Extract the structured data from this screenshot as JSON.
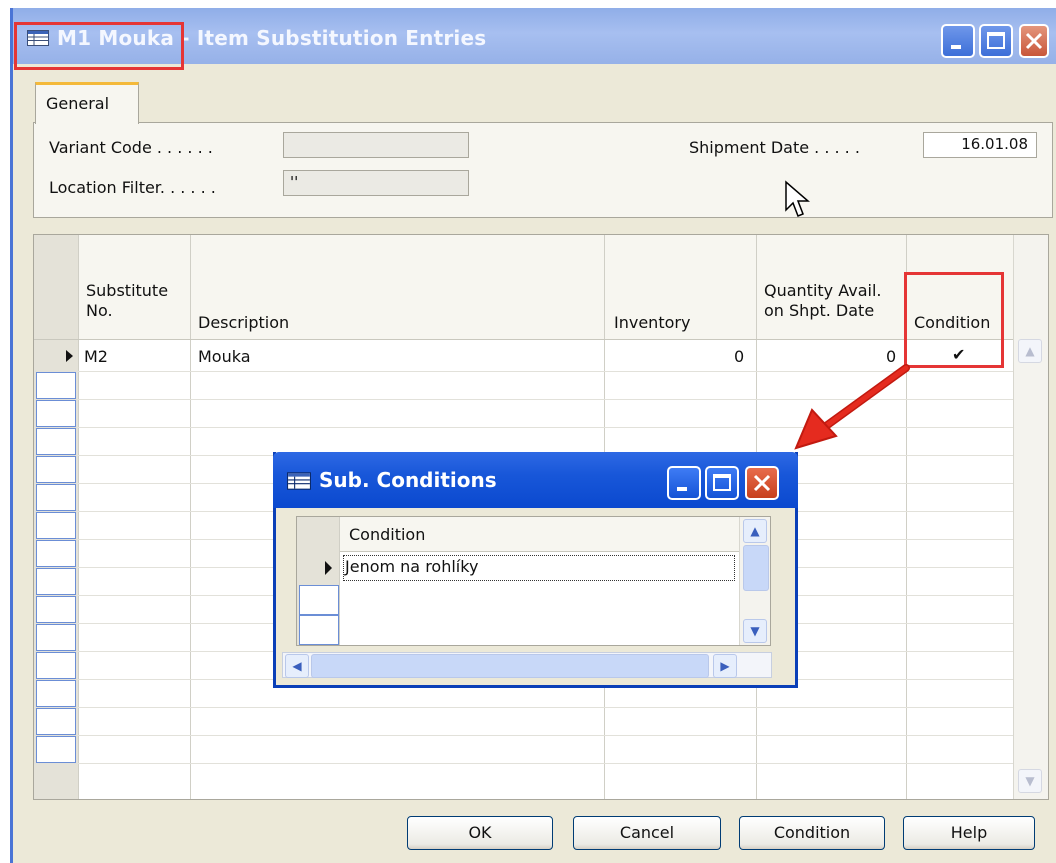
{
  "window": {
    "title": "M1 Mouka - Item Substitution Entries"
  },
  "tabs": [
    {
      "label": "General"
    }
  ],
  "form": {
    "variant_code_label": "Variant Code . . . . . .",
    "variant_code_value": "",
    "location_filter_label": "Location Filter. . . . . .",
    "location_filter_value": "''",
    "shipment_date_label": "Shipment Date . . . . .",
    "shipment_date_value": "16.01.08"
  },
  "table": {
    "columns": [
      "Substitute No.",
      "Description",
      "Inventory",
      "Quantity Avail. on Shpt. Date",
      "Condition"
    ],
    "col_substitute_l1": "Substitute",
    "col_substitute_l2": "No.",
    "col_description": "Description",
    "col_inventory": "Inventory",
    "col_qty_l1": "Quantity Avail.",
    "col_qty_l2": "on Shpt. Date",
    "col_condition": "Condition",
    "rows": [
      {
        "substitute_no": "M2",
        "description": "Mouka",
        "inventory": "0",
        "quantity_avail": "0",
        "condition": "✔"
      }
    ]
  },
  "popup": {
    "title": "Sub. Conditions",
    "column": "Condition",
    "rows": [
      {
        "condition": "Jenom na rohlíky"
      }
    ]
  },
  "buttons": {
    "ok": "OK",
    "cancel": "Cancel",
    "condition": "Condition",
    "help": "Help"
  },
  "colors": {
    "highlight": "#e53535",
    "arrow": "#e52b1f",
    "xp_blue": "#0b49cf"
  }
}
